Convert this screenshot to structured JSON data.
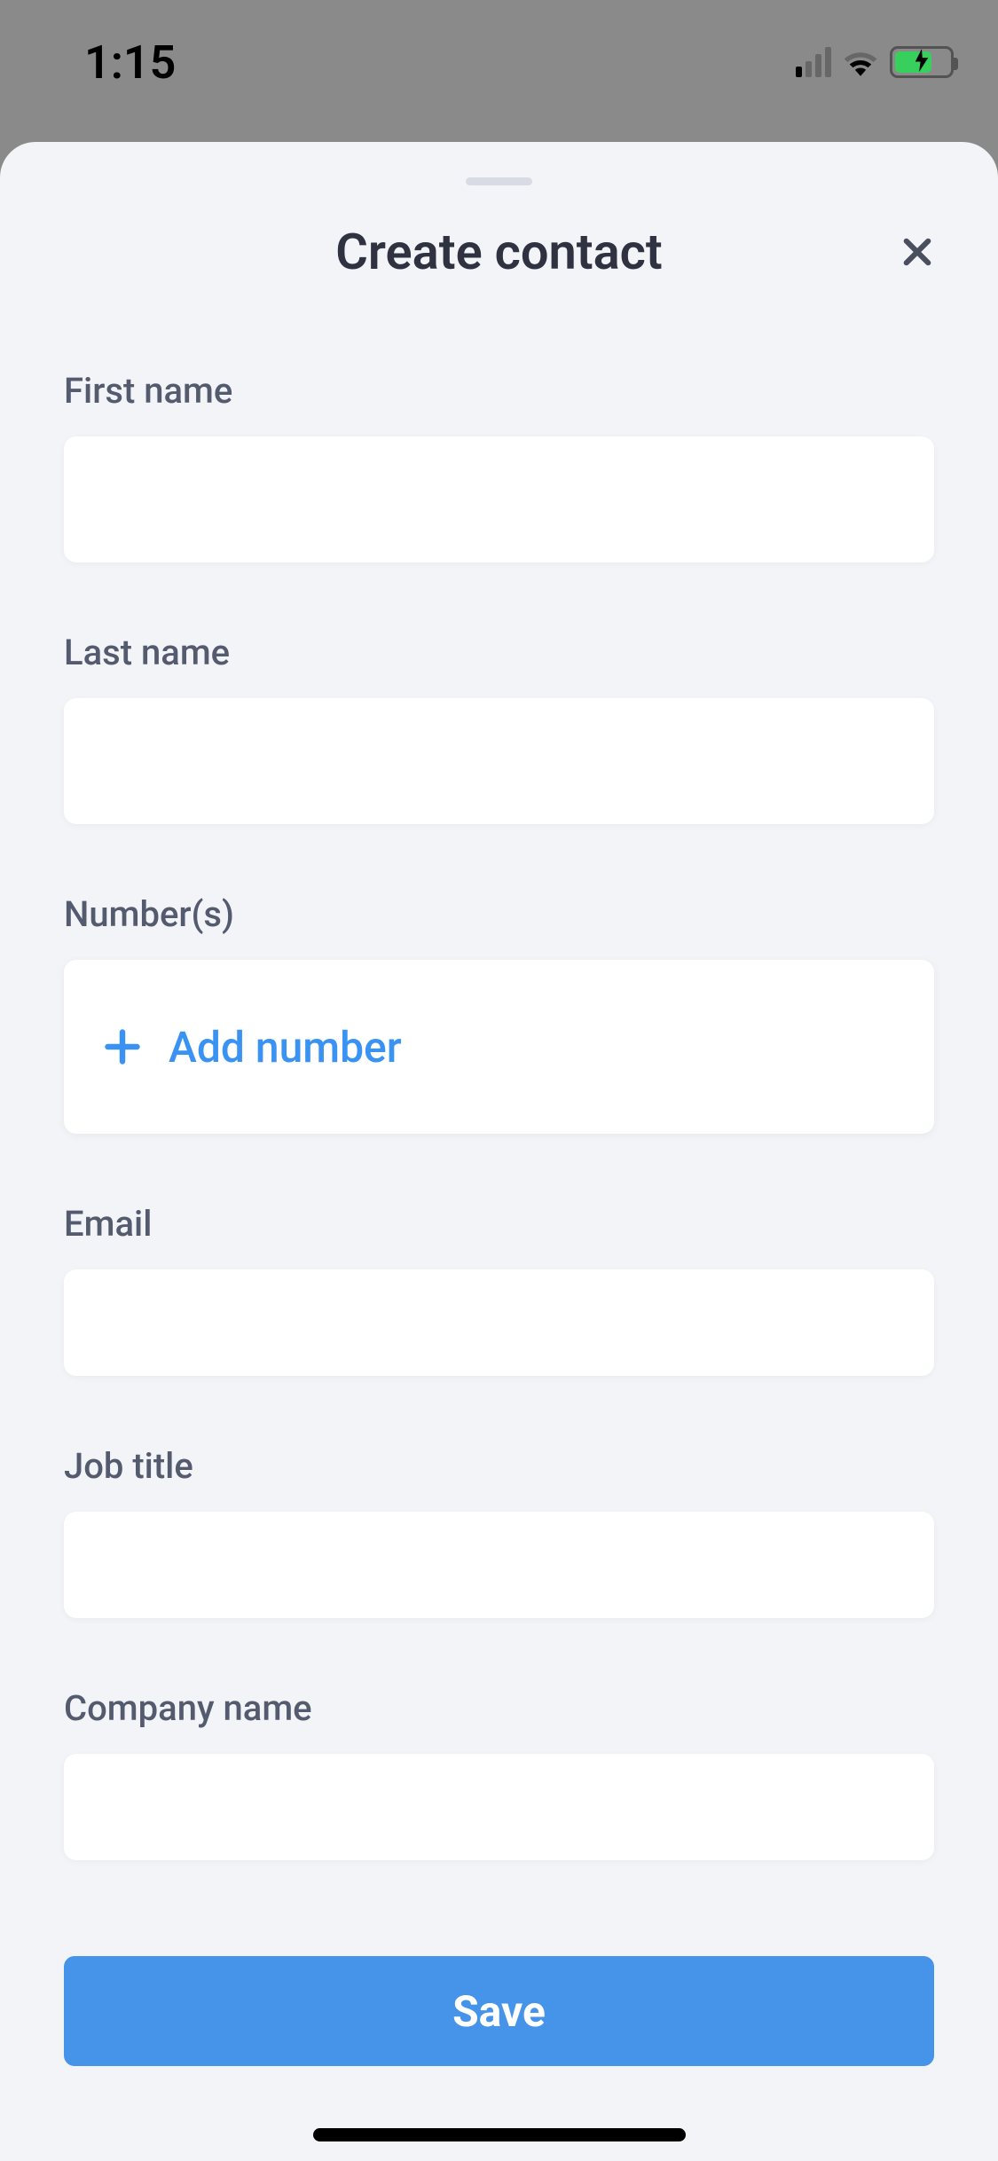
{
  "status": {
    "time": "1:15"
  },
  "header": {
    "title": "Create contact"
  },
  "fields": {
    "firstName": {
      "label": "First name",
      "value": ""
    },
    "lastName": {
      "label": "Last name",
      "value": ""
    },
    "numbers": {
      "label": "Number(s)",
      "addLabel": "Add number"
    },
    "email": {
      "label": "Email",
      "value": ""
    },
    "jobTitle": {
      "label": "Job title",
      "value": ""
    },
    "companyName": {
      "label": "Company name",
      "value": ""
    }
  },
  "buttons": {
    "save": "Save"
  },
  "colors": {
    "accent": "#4693ea",
    "link": "#3a93f3",
    "sheetBg": "#f2f4f8",
    "textMuted": "#555b6e",
    "titleText": "#2e3241"
  }
}
